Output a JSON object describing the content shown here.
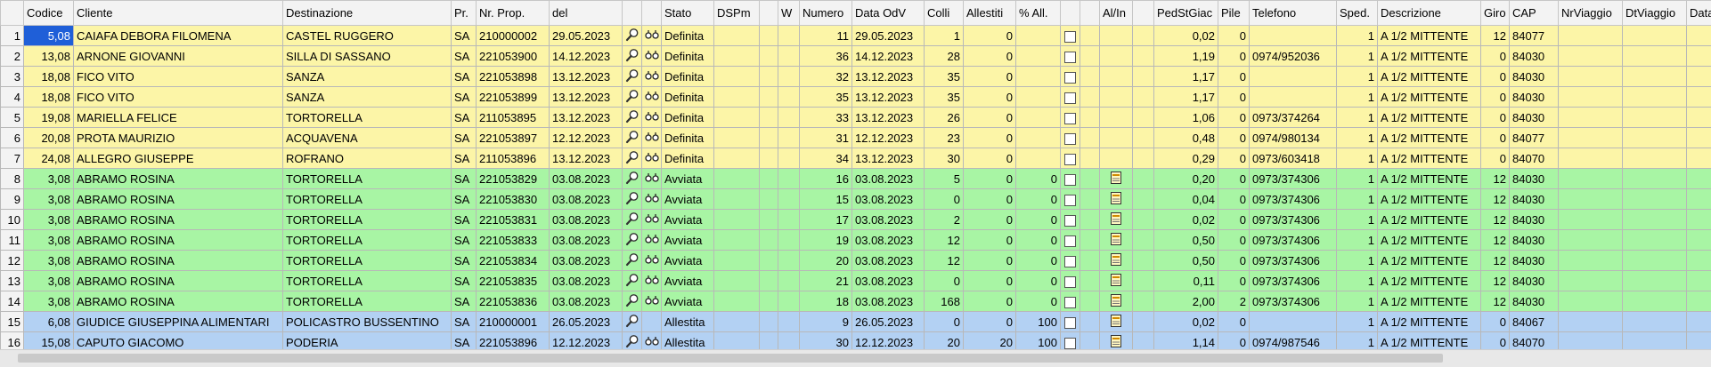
{
  "colors": {
    "definita": "#fcf5a7",
    "avviata": "#a8f5a4",
    "allestita": "#b3d1f3",
    "selection": "#1f5fd8"
  },
  "icons": {
    "view": "magnifier-icon",
    "link": "glasses-icon",
    "note": "note-icon"
  },
  "columns": [
    {
      "key": "rn",
      "label": "",
      "w": 26,
      "cls": "rn"
    },
    {
      "key": "codice",
      "label": "Codice",
      "w": 56,
      "cls": "r"
    },
    {
      "key": "cliente",
      "label": "Cliente",
      "w": 235,
      "cls": ""
    },
    {
      "key": "destinazione",
      "label": "Destinazione",
      "w": 189,
      "cls": ""
    },
    {
      "key": "pr",
      "label": "Pr.",
      "w": 28,
      "cls": ""
    },
    {
      "key": "nrprop",
      "label": "Nr. Prop.",
      "w": 82,
      "cls": ""
    },
    {
      "key": "del",
      "label": "del",
      "w": 82,
      "cls": ""
    },
    {
      "key": "view",
      "label": "",
      "w": 22,
      "cls": "c"
    },
    {
      "key": "link",
      "label": "",
      "w": 22,
      "cls": "c"
    },
    {
      "key": "stato",
      "label": "Stato",
      "w": 59,
      "cls": ""
    },
    {
      "key": "dspm",
      "label": "DSPm",
      "w": 51,
      "cls": ""
    },
    {
      "key": "x1",
      "label": "",
      "w": 21,
      "cls": ""
    },
    {
      "key": "w",
      "label": "W",
      "w": 24,
      "cls": "r"
    },
    {
      "key": "numero",
      "label": "Numero",
      "w": 59,
      "cls": "r"
    },
    {
      "key": "dataodv",
      "label": "Data OdV",
      "w": 81,
      "cls": ""
    },
    {
      "key": "colli",
      "label": "Colli",
      "w": 44,
      "cls": "r"
    },
    {
      "key": "allestiti",
      "label": "Allestiti",
      "w": 59,
      "cls": "r"
    },
    {
      "key": "pctall",
      "label": "% All.",
      "w": 50,
      "cls": "r"
    },
    {
      "key": "chk",
      "label": "",
      "w": 22,
      "cls": "c"
    },
    {
      "key": "x2",
      "label": "",
      "w": 22,
      "cls": ""
    },
    {
      "key": "alin",
      "label": "Al/In",
      "w": 37,
      "cls": "c"
    },
    {
      "key": "x3",
      "label": "",
      "w": 24,
      "cls": ""
    },
    {
      "key": "pedst",
      "label": "PedStGiac",
      "w": 72,
      "cls": "r"
    },
    {
      "key": "pile",
      "label": "Pile",
      "w": 35,
      "cls": "r"
    },
    {
      "key": "telefono",
      "label": "Telefono",
      "w": 98,
      "cls": ""
    },
    {
      "key": "sped",
      "label": "Sped.",
      "w": 46,
      "cls": "r"
    },
    {
      "key": "descrizione",
      "label": "Descrizione",
      "w": 116,
      "cls": ""
    },
    {
      "key": "giro",
      "label": "Giro",
      "w": 32,
      "cls": "r"
    },
    {
      "key": "cap",
      "label": "CAP",
      "w": 55,
      "cls": ""
    },
    {
      "key": "nrviaggio",
      "label": "NrViaggio",
      "w": 72,
      "cls": ""
    },
    {
      "key": "dtviaggio",
      "label": "DtViaggio",
      "w": 72,
      "cls": ""
    },
    {
      "key": "dataorar",
      "label": "DataOrar",
      "w": 97,
      "cls": ""
    }
  ],
  "rows": [
    {
      "rn": "1",
      "codice": "5,08",
      "cliente": "CAIAFA DEBORA FILOMENA",
      "destinazione": "CASTEL RUGGERO",
      "pr": "SA",
      "nrprop": "210000002",
      "del": "29.05.2023",
      "stato": "Definita",
      "numero": "11",
      "dataodv": "29.05.2023",
      "colli": "1",
      "allestiti": "0",
      "pctall": "",
      "alin": false,
      "pedst": "0,02",
      "pile": "0",
      "telefono": "",
      "sped": "1",
      "descrizione": "A 1/2 MITTENTE",
      "giro": "12",
      "cap": "84077",
      "link": true,
      "style": "yellow",
      "selected": true
    },
    {
      "rn": "2",
      "codice": "13,08",
      "cliente": "ARNONE GIOVANNI",
      "destinazione": "SILLA DI SASSANO",
      "pr": "SA",
      "nrprop": "221053900",
      "del": "14.12.2023",
      "stato": "Definita",
      "numero": "36",
      "dataodv": "14.12.2023",
      "colli": "28",
      "allestiti": "0",
      "pctall": "",
      "alin": false,
      "pedst": "1,19",
      "pile": "0",
      "telefono": "0974/952036",
      "sped": "1",
      "descrizione": "A 1/2 MITTENTE",
      "giro": "0",
      "cap": "84030",
      "link": true,
      "style": "yellow"
    },
    {
      "rn": "3",
      "codice": "18,08",
      "cliente": "FICO VITO",
      "destinazione": "SANZA",
      "pr": "SA",
      "nrprop": "221053898",
      "del": "13.12.2023",
      "stato": "Definita",
      "numero": "32",
      "dataodv": "13.12.2023",
      "colli": "35",
      "allestiti": "0",
      "pctall": "",
      "alin": false,
      "pedst": "1,17",
      "pile": "0",
      "telefono": "",
      "sped": "1",
      "descrizione": "A 1/2 MITTENTE",
      "giro": "0",
      "cap": "84030",
      "link": true,
      "style": "yellow"
    },
    {
      "rn": "4",
      "codice": "18,08",
      "cliente": "FICO VITO",
      "destinazione": "SANZA",
      "pr": "SA",
      "nrprop": "221053899",
      "del": "13.12.2023",
      "stato": "Definita",
      "numero": "35",
      "dataodv": "13.12.2023",
      "colli": "35",
      "allestiti": "0",
      "pctall": "",
      "alin": false,
      "pedst": "1,17",
      "pile": "0",
      "telefono": "",
      "sped": "1",
      "descrizione": "A 1/2 MITTENTE",
      "giro": "0",
      "cap": "84030",
      "link": true,
      "style": "yellow"
    },
    {
      "rn": "5",
      "codice": "19,08",
      "cliente": "MARIELLA FELICE",
      "destinazione": "TORTORELLA",
      "pr": "SA",
      "nrprop": "211053895",
      "del": "13.12.2023",
      "stato": "Definita",
      "numero": "33",
      "dataodv": "13.12.2023",
      "colli": "26",
      "allestiti": "0",
      "pctall": "",
      "alin": false,
      "pedst": "1,06",
      "pile": "0",
      "telefono": "0973/374264",
      "sped": "1",
      "descrizione": "A 1/2 MITTENTE",
      "giro": "0",
      "cap": "84030",
      "link": true,
      "style": "yellow"
    },
    {
      "rn": "6",
      "codice": "20,08",
      "cliente": "PROTA MAURIZIO",
      "destinazione": "ACQUAVENA",
      "pr": "SA",
      "nrprop": "221053897",
      "del": "12.12.2023",
      "stato": "Definita",
      "numero": "31",
      "dataodv": "12.12.2023",
      "colli": "23",
      "allestiti": "0",
      "pctall": "",
      "alin": false,
      "pedst": "0,48",
      "pile": "0",
      "telefono": "0974/980134",
      "sped": "1",
      "descrizione": "A 1/2 MITTENTE",
      "giro": "0",
      "cap": "84077",
      "link": true,
      "style": "yellow"
    },
    {
      "rn": "7",
      "codice": "24,08",
      "cliente": "ALLEGRO GIUSEPPE",
      "destinazione": "ROFRANO",
      "pr": "SA",
      "nrprop": "211053896",
      "del": "13.12.2023",
      "stato": "Definita",
      "numero": "34",
      "dataodv": "13.12.2023",
      "colli": "30",
      "allestiti": "0",
      "pctall": "",
      "alin": false,
      "pedst": "0,29",
      "pile": "0",
      "telefono": "0973/603418",
      "sped": "1",
      "descrizione": "A 1/2 MITTENTE",
      "giro": "0",
      "cap": "84070",
      "link": true,
      "style": "yellow"
    },
    {
      "rn": "8",
      "codice": "3,08",
      "cliente": "ABRAMO ROSINA",
      "destinazione": "TORTORELLA",
      "pr": "SA",
      "nrprop": "221053829",
      "del": "03.08.2023",
      "stato": "Avviata",
      "numero": "16",
      "dataodv": "03.08.2023",
      "colli": "5",
      "allestiti": "0",
      "pctall": "0",
      "alin": true,
      "pedst": "0,20",
      "pile": "0",
      "telefono": "0973/374306",
      "sped": "1",
      "descrizione": "A 1/2 MITTENTE",
      "giro": "12",
      "cap": "84030",
      "link": true,
      "style": "green"
    },
    {
      "rn": "9",
      "codice": "3,08",
      "cliente": "ABRAMO ROSINA",
      "destinazione": "TORTORELLA",
      "pr": "SA",
      "nrprop": "221053830",
      "del": "03.08.2023",
      "stato": "Avviata",
      "numero": "15",
      "dataodv": "03.08.2023",
      "colli": "0",
      "allestiti": "0",
      "pctall": "0",
      "alin": true,
      "pedst": "0,04",
      "pile": "0",
      "telefono": "0973/374306",
      "sped": "1",
      "descrizione": "A 1/2 MITTENTE",
      "giro": "12",
      "cap": "84030",
      "link": true,
      "style": "green"
    },
    {
      "rn": "10",
      "codice": "3,08",
      "cliente": "ABRAMO ROSINA",
      "destinazione": "TORTORELLA",
      "pr": "SA",
      "nrprop": "221053831",
      "del": "03.08.2023",
      "stato": "Avviata",
      "numero": "17",
      "dataodv": "03.08.2023",
      "colli": "2",
      "allestiti": "0",
      "pctall": "0",
      "alin": true,
      "pedst": "0,02",
      "pile": "0",
      "telefono": "0973/374306",
      "sped": "1",
      "descrizione": "A 1/2 MITTENTE",
      "giro": "12",
      "cap": "84030",
      "link": true,
      "style": "green"
    },
    {
      "rn": "11",
      "codice": "3,08",
      "cliente": "ABRAMO ROSINA",
      "destinazione": "TORTORELLA",
      "pr": "SA",
      "nrprop": "221053833",
      "del": "03.08.2023",
      "stato": "Avviata",
      "numero": "19",
      "dataodv": "03.08.2023",
      "colli": "12",
      "allestiti": "0",
      "pctall": "0",
      "alin": true,
      "pedst": "0,50",
      "pile": "0",
      "telefono": "0973/374306",
      "sped": "1",
      "descrizione": "A 1/2 MITTENTE",
      "giro": "12",
      "cap": "84030",
      "link": true,
      "style": "green"
    },
    {
      "rn": "12",
      "codice": "3,08",
      "cliente": "ABRAMO ROSINA",
      "destinazione": "TORTORELLA",
      "pr": "SA",
      "nrprop": "221053834",
      "del": "03.08.2023",
      "stato": "Avviata",
      "numero": "20",
      "dataodv": "03.08.2023",
      "colli": "12",
      "allestiti": "0",
      "pctall": "0",
      "alin": true,
      "pedst": "0,50",
      "pile": "0",
      "telefono": "0973/374306",
      "sped": "1",
      "descrizione": "A 1/2 MITTENTE",
      "giro": "12",
      "cap": "84030",
      "link": true,
      "style": "green"
    },
    {
      "rn": "13",
      "codice": "3,08",
      "cliente": "ABRAMO ROSINA",
      "destinazione": "TORTORELLA",
      "pr": "SA",
      "nrprop": "221053835",
      "del": "03.08.2023",
      "stato": "Avviata",
      "numero": "21",
      "dataodv": "03.08.2023",
      "colli": "0",
      "allestiti": "0",
      "pctall": "0",
      "alin": true,
      "pedst": "0,11",
      "pile": "0",
      "telefono": "0973/374306",
      "sped": "1",
      "descrizione": "A 1/2 MITTENTE",
      "giro": "12",
      "cap": "84030",
      "link": true,
      "style": "green"
    },
    {
      "rn": "14",
      "codice": "3,08",
      "cliente": "ABRAMO ROSINA",
      "destinazione": "TORTORELLA",
      "pr": "SA",
      "nrprop": "221053836",
      "del": "03.08.2023",
      "stato": "Avviata",
      "numero": "18",
      "dataodv": "03.08.2023",
      "colli": "168",
      "allestiti": "0",
      "pctall": "0",
      "alin": true,
      "pedst": "2,00",
      "pile": "2",
      "telefono": "0973/374306",
      "sped": "1",
      "descrizione": "A 1/2 MITTENTE",
      "giro": "12",
      "cap": "84030",
      "link": true,
      "style": "green"
    },
    {
      "rn": "15",
      "codice": "6,08",
      "cliente": "GIUDICE GIUSEPPINA ALIMENTARI",
      "destinazione": "POLICASTRO BUSSENTINO",
      "pr": "SA",
      "nrprop": "210000001",
      "del": "26.05.2023",
      "stato": "Allestita",
      "numero": "9",
      "dataodv": "26.05.2023",
      "colli": "0",
      "allestiti": "0",
      "pctall": "100",
      "alin": true,
      "pedst": "0,02",
      "pile": "0",
      "telefono": "",
      "sped": "1",
      "descrizione": "A 1/2 MITTENTE",
      "giro": "0",
      "cap": "84067",
      "link": false,
      "style": "blue"
    },
    {
      "rn": "16",
      "codice": "15,08",
      "cliente": "CAPUTO GIACOMO",
      "destinazione": "PODERIA",
      "pr": "SA",
      "nrprop": "221053896",
      "del": "12.12.2023",
      "stato": "Allestita",
      "numero": "30",
      "dataodv": "12.12.2023",
      "colli": "20",
      "allestiti": "20",
      "pctall": "100",
      "alin": true,
      "pedst": "1,14",
      "pile": "0",
      "telefono": "0974/987546",
      "sped": "1",
      "descrizione": "A 1/2 MITTENTE",
      "giro": "0",
      "cap": "84070",
      "link": true,
      "style": "blue"
    }
  ]
}
